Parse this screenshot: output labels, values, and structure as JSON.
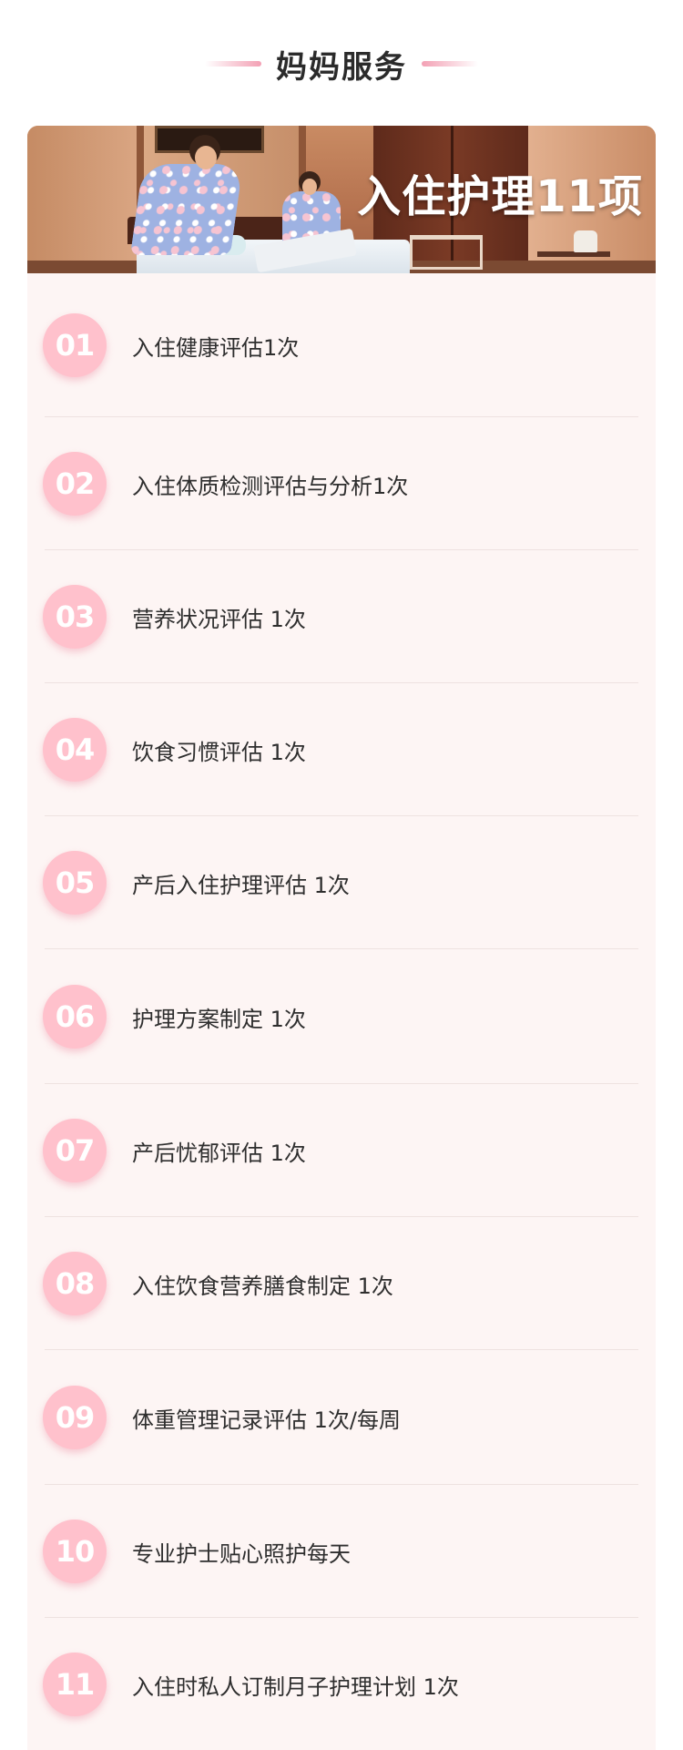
{
  "header": {
    "title": "妈妈服务"
  },
  "banner": {
    "title": "入住护理11项"
  },
  "items": [
    {
      "number": "01",
      "label": "入住健康评估1次"
    },
    {
      "number": "02",
      "label": "入住体质检测评估与分析1次"
    },
    {
      "number": "03",
      "label": "营养状况评估 1次"
    },
    {
      "number": "04",
      "label": "饮食习惯评估 1次"
    },
    {
      "number": "05",
      "label": "产后入住护理评估 1次"
    },
    {
      "number": "06",
      "label": "护理方案制定 1次"
    },
    {
      "number": "07",
      "label": "产后忧郁评估 1次"
    },
    {
      "number": "08",
      "label": "入住饮食营养膳食制定 1次"
    },
    {
      "number": "09",
      "label": "体重管理记录评估 1次/每周"
    },
    {
      "number": "10",
      "label": "专业护士贴心照护每天"
    },
    {
      "number": "11",
      "label": "入住时私人订制月子护理计划 1次"
    }
  ],
  "colors": {
    "accent_pink": "#ffc1cc",
    "card_background": "#fdf5f4",
    "text_dark": "#2e2e2e"
  }
}
